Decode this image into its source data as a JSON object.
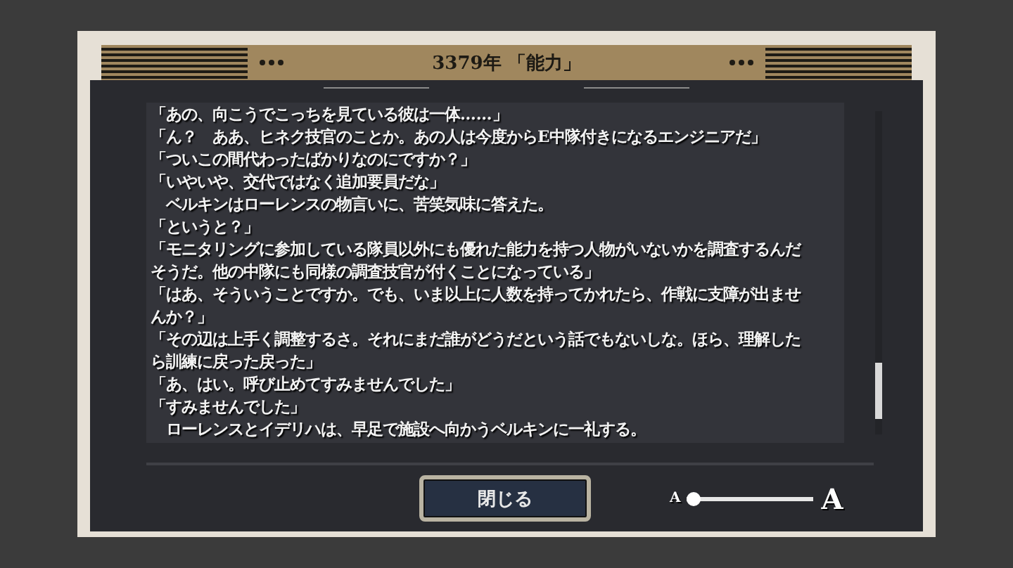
{
  "header": {
    "title": "3379年 「能力」"
  },
  "dialogue": [
    "「あの、向こうでこっちを見ている彼は一体……」",
    "「ん？　ああ、ヒネク技官のことか。あの人は今度からE中隊付きになるエンジニアだ」",
    "「ついこの間代わったばかりなのにですか？」",
    "「いやいや、交代ではなく追加要員だな」",
    "　ベルキンはローレンスの物言いに、苦笑気味に答えた。",
    "「というと？」",
    "「モニタリングに参加している隊員以外にも優れた能力を持つ人物がいないかを調査するんだ",
    "そうだ。他の中隊にも同様の調査技官が付くことになっている」",
    "「はあ、そういうことですか。でも、いま以上に人数を持ってかれたら、作戦に支障が出ませ",
    "んか？」",
    "「その辺は上手く調整するさ。それにまだ誰がどうだという話でもないしな。ほら、理解した",
    "ら訓練に戻った戻った」",
    "「あ、はい。呼び止めてすみませんでした」",
    "「すみませんでした」",
    "　ローレンスとイデリハは、早足で施設へ向かうベルキンに一礼する。"
  ],
  "close_button": {
    "label": "閉じる"
  },
  "text_size": {
    "small_label": "A",
    "large_label": "A",
    "level": 0
  }
}
